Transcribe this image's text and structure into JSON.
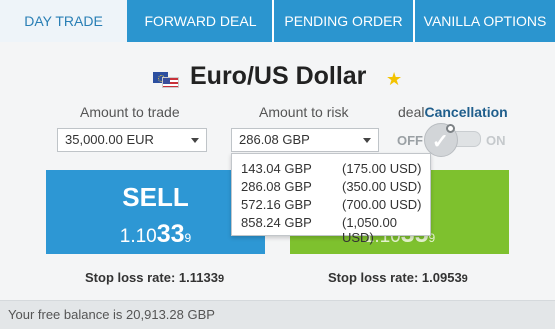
{
  "tabs": [
    {
      "label": "DAY TRADE"
    },
    {
      "label": "FORWARD DEAL"
    },
    {
      "label": "PENDING ORDER"
    },
    {
      "label": "VANILLA OPTIONS"
    }
  ],
  "pair": {
    "title": "Euro/US Dollar",
    "favorite_icon": "star-icon",
    "flag_icon": "eu-us-flag-icon"
  },
  "amount_to_trade": {
    "label": "Amount to trade",
    "value": "35,000.00 EUR"
  },
  "amount_to_risk": {
    "label": "Amount to risk",
    "value": "286.08 GBP",
    "options": [
      {
        "gbp": "143.04 GBP",
        "usd": "(175.00 USD)"
      },
      {
        "gbp": "286.08 GBP",
        "usd": "(350.00 USD)"
      },
      {
        "gbp": "572.16 GBP",
        "usd": "(700.00 USD)"
      },
      {
        "gbp": "858.24 GBP",
        "usd": "(1,050.00 USD)"
      }
    ]
  },
  "deal_cancellation": {
    "label_prefix": "deal",
    "label_bold": "Cancellation",
    "off_label": "OFF",
    "on_label": "ON",
    "state": "off"
  },
  "sell": {
    "label": "SELL",
    "price_prefix": "1.10",
    "price_big": "33",
    "price_small": "9"
  },
  "buy": {
    "price_prefix": "1.10",
    "price_big": "35",
    "price_small": "9"
  },
  "stop_loss_sell": {
    "prefix": "Stop loss rate: 1.1133",
    "small": "9"
  },
  "stop_loss_buy": {
    "prefix": "Stop loss rate: 1.0953",
    "small": "9"
  },
  "footer": {
    "balance_text": "Your free balance is 20,913.28 GBP"
  },
  "colors": {
    "tab_bar": "#2b95cf",
    "sell": "#2d97d4",
    "buy": "#7ec12e",
    "star": "#f3c300"
  }
}
